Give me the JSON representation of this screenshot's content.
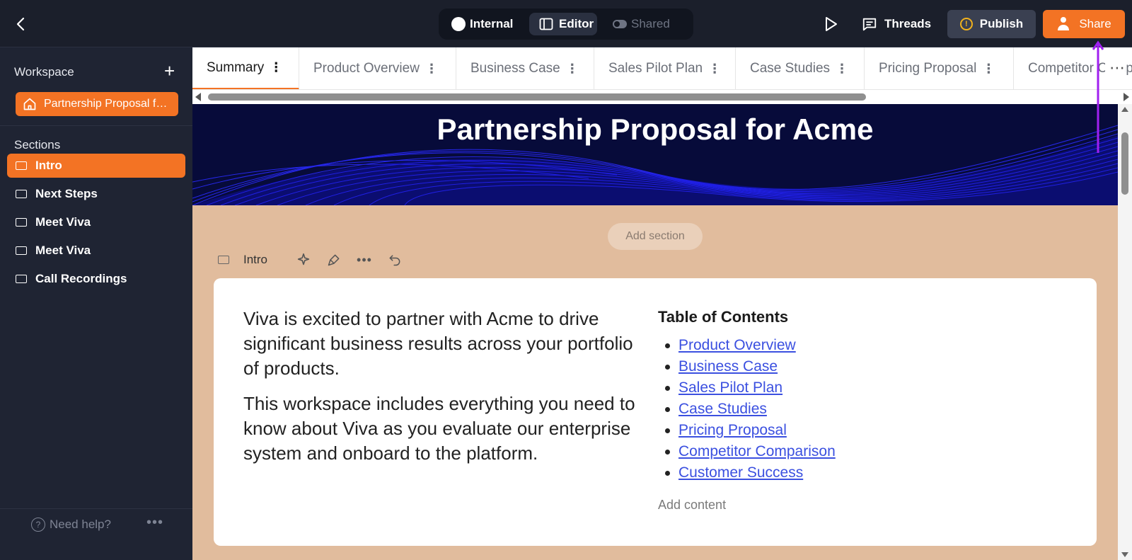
{
  "topbar": {
    "modes": {
      "internal": "Internal",
      "editor": "Editor",
      "shared": "Shared"
    },
    "threads_label": "Threads",
    "publish_label": "Publish",
    "share_label": "Share",
    "accent_color": "#f37324"
  },
  "sidebar": {
    "workspace_label": "Workspace",
    "workspace_item": "Partnership Proposal for Acme",
    "sections_label": "Sections",
    "items": [
      {
        "label": "Intro",
        "active": true
      },
      {
        "label": "Next Steps",
        "active": false
      },
      {
        "label": "Meet Viva",
        "active": false
      },
      {
        "label": "Meet Viva",
        "active": false
      },
      {
        "label": "Call Recordings",
        "active": false
      }
    ],
    "help_label": "Need help?"
  },
  "tabs": [
    {
      "label": "Summary",
      "active": true
    },
    {
      "label": "Product Overview",
      "active": false
    },
    {
      "label": "Business Case",
      "active": false
    },
    {
      "label": "Sales Pilot Plan",
      "active": false
    },
    {
      "label": "Case Studies",
      "active": false
    },
    {
      "label": "Pricing Proposal",
      "active": false
    },
    {
      "label": "Competitor Comparison",
      "active": false
    }
  ],
  "content": {
    "banner_title": "Partnership Proposal for Acme",
    "add_section_label": "Add section",
    "section_name": "Intro",
    "paragraphs": [
      "Viva is excited to partner with Acme to drive significant business results across your portfolio of products.",
      "This workspace includes everything you need to know about Viva as you evaluate our enterprise system and onboard to the platform."
    ],
    "toc_title": "Table of Contents",
    "toc_items": [
      "Product Overview",
      "Business Case",
      "Sales Pilot Plan",
      "Case Studies",
      "Pricing Proposal",
      "Competitor Comparison",
      "Customer Success"
    ],
    "add_content_label": "Add content",
    "background_color": "#e1bc9d",
    "banner_color": "#070b3a"
  }
}
